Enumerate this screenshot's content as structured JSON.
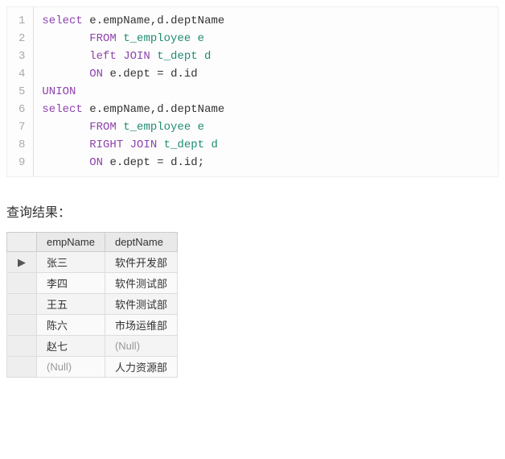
{
  "code": {
    "lines_count": 9,
    "lines": [
      [
        {
          "t": "select ",
          "c": "kw"
        },
        {
          "t": "e",
          "c": "ident"
        },
        {
          "t": ".",
          "c": "dot"
        },
        {
          "t": "empName",
          "c": "ident"
        },
        {
          "t": ",",
          "c": "ident"
        },
        {
          "t": "d",
          "c": "ident"
        },
        {
          "t": ".",
          "c": "dot"
        },
        {
          "t": "deptName",
          "c": "ident"
        }
      ],
      [
        {
          "t": "       ",
          "c": ""
        },
        {
          "t": "FROM ",
          "c": "kw"
        },
        {
          "t": "t_employee e",
          "c": "str"
        }
      ],
      [
        {
          "t": "       ",
          "c": ""
        },
        {
          "t": "left JOIN ",
          "c": "kw"
        },
        {
          "t": "t_dept d",
          "c": "str"
        }
      ],
      [
        {
          "t": "       ",
          "c": ""
        },
        {
          "t": "ON ",
          "c": "kw"
        },
        {
          "t": "e",
          "c": "ident"
        },
        {
          "t": ".",
          "c": "dot"
        },
        {
          "t": "dept ",
          "c": "ident"
        },
        {
          "t": "= ",
          "c": "ident"
        },
        {
          "t": "d",
          "c": "ident"
        },
        {
          "t": ".",
          "c": "dot"
        },
        {
          "t": "id",
          "c": "ident"
        }
      ],
      [
        {
          "t": "UNION",
          "c": "kw"
        }
      ],
      [
        {
          "t": "select ",
          "c": "kw"
        },
        {
          "t": "e",
          "c": "ident"
        },
        {
          "t": ".",
          "c": "dot"
        },
        {
          "t": "empName",
          "c": "ident"
        },
        {
          "t": ",",
          "c": "ident"
        },
        {
          "t": "d",
          "c": "ident"
        },
        {
          "t": ".",
          "c": "dot"
        },
        {
          "t": "deptName",
          "c": "ident"
        }
      ],
      [
        {
          "t": "       ",
          "c": ""
        },
        {
          "t": "FROM ",
          "c": "kw"
        },
        {
          "t": "t_employee e",
          "c": "str"
        }
      ],
      [
        {
          "t": "       ",
          "c": ""
        },
        {
          "t": "RIGHT JOIN ",
          "c": "kw"
        },
        {
          "t": "t_dept d",
          "c": "str"
        }
      ],
      [
        {
          "t": "       ",
          "c": ""
        },
        {
          "t": "ON ",
          "c": "kw"
        },
        {
          "t": "e",
          "c": "ident"
        },
        {
          "t": ".",
          "c": "dot"
        },
        {
          "t": "dept ",
          "c": "ident"
        },
        {
          "t": "= ",
          "c": "ident"
        },
        {
          "t": "d",
          "c": "ident"
        },
        {
          "t": ".",
          "c": "dot"
        },
        {
          "t": "id",
          "c": "ident"
        },
        {
          "t": ";",
          "c": "ident"
        }
      ]
    ]
  },
  "section_title": "查询结果：",
  "result": {
    "headers": [
      "empName",
      "deptName"
    ],
    "rows": [
      {
        "marker": "▶",
        "cells": [
          "张三",
          "软件开发部"
        ]
      },
      {
        "marker": "",
        "cells": [
          "李四",
          "软件测试部"
        ]
      },
      {
        "marker": "",
        "cells": [
          "王五",
          "软件测试部"
        ]
      },
      {
        "marker": "",
        "cells": [
          "陈六",
          "市场运维部"
        ]
      },
      {
        "marker": "",
        "cells": [
          "赵七",
          "(Null)"
        ]
      },
      {
        "marker": "",
        "cells": [
          "(Null)",
          "人力资源部"
        ]
      }
    ]
  }
}
